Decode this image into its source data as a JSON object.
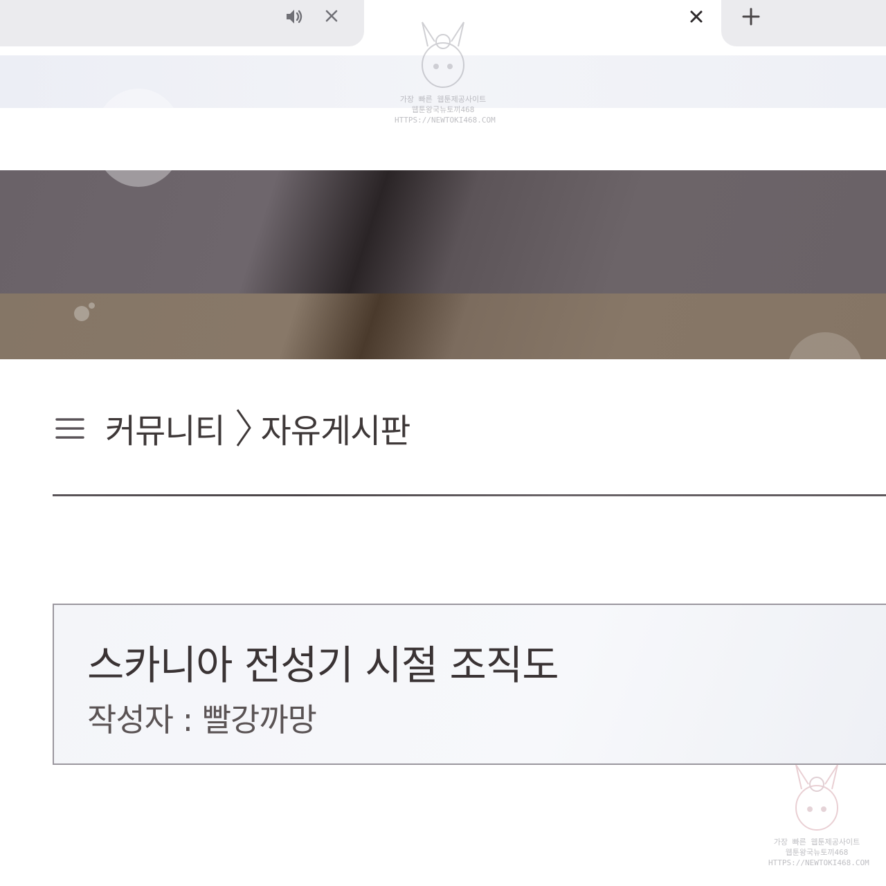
{
  "browser": {
    "tabs": [
      {
        "state": "inactive",
        "audio_icon": "speaker-icon",
        "close_icon": "close-icon"
      },
      {
        "state": "active",
        "close_icon": "close-icon"
      }
    ],
    "new_tab_icon": "plus-icon"
  },
  "page": {
    "breadcrumb": {
      "menu_icon": "hamburger-menu-icon",
      "section": "커뮤니티",
      "separator_icon": "chevron-right-icon",
      "board": "자유게시판"
    },
    "post": {
      "title": "스카니아 전성기 시절 조직도",
      "author_label": "작성자 : 빨강까망"
    }
  },
  "watermark": {
    "line1": "가장 빠른 웹툰제공사이트",
    "line2": "웹툰왕국뉴토끼468",
    "line3": "HTTPS://NEWTOKI468.COM"
  },
  "colors": {
    "text_dark": "#3e3838",
    "tab_bg": "#ebebee",
    "banner_top": "#6a6268",
    "banner_bottom": "#857666",
    "card_border": "#9a969e"
  }
}
